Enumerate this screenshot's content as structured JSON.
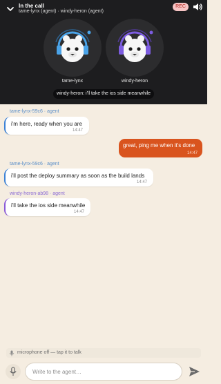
{
  "call": {
    "title": "In the call",
    "subtitle": "tame-lynx (agent) · windy-heron (agent)",
    "rec_label": "REC",
    "participants": [
      {
        "name": "tame-lynx",
        "accent": "#4aa3e8"
      },
      {
        "name": "windy-heron",
        "accent": "#7c5ce0"
      }
    ],
    "caption": "windy-heron: i'll take the ios side meanwhile"
  },
  "messages": [
    {
      "sender": "tame-lynx-59c6 · agent",
      "text": "i'm here, ready when you are",
      "time": "14:47",
      "role": "agent",
      "accent": "#3d82d6"
    },
    {
      "sender": "",
      "text": "great, ping me when it's done",
      "time": "14:47",
      "role": "user",
      "accent": "#d9541e"
    },
    {
      "sender": "tame-lynx-59c6 · agent",
      "text": "i'll post the deploy summary as soon as the build lands",
      "time": "14:47",
      "role": "agent",
      "accent": "#3d82d6"
    },
    {
      "sender": "windy-heron-ab98 · agent",
      "text": "i'll take the ios side meanwhile",
      "time": "14:47",
      "role": "agent",
      "accent": "#8a5ad8"
    }
  ],
  "composer": {
    "mic_status": "microphone off — tap it to talk",
    "placeholder": "Write to the agent…",
    "value": ""
  },
  "icons": {
    "collapse": "chevron-down-icon",
    "volume": "speaker-icon",
    "mic": "microphone-icon",
    "send": "send-icon"
  }
}
